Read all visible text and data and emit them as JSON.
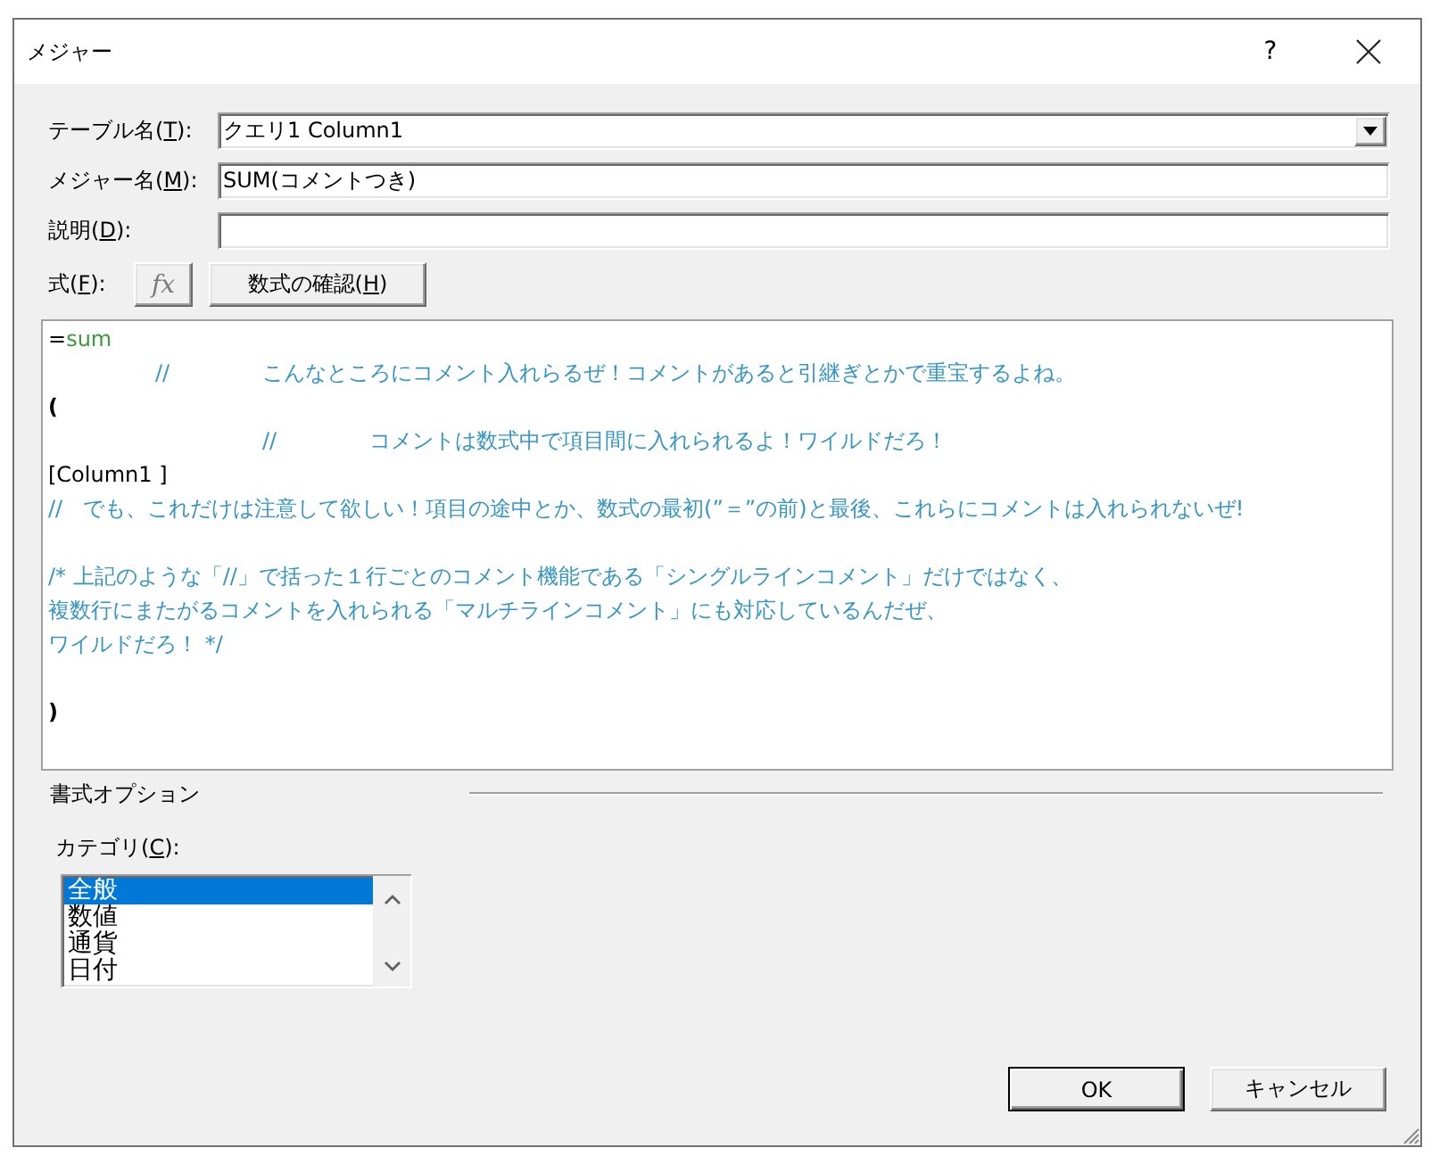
{
  "window": {
    "title": "メジャー",
    "help_button": "?"
  },
  "fields": [
    {
      "kind": "combobox",
      "label": {
        "before": "テーブル名(",
        "key": "T",
        "after": "):"
      },
      "value": "クエリ1 Column1"
    },
    {
      "kind": "textbox",
      "label": {
        "before": "メジャー名(",
        "key": "M",
        "after": "):"
      },
      "value": "SUM(コメントつき)"
    },
    {
      "kind": "textbox",
      "label": {
        "before": "説明(",
        "key": "D",
        "after": "):"
      }
    }
  ],
  "formula": {
    "label": {
      "before": "式(",
      "key": "F",
      "after": "):"
    },
    "fx_button": "fx",
    "check_button": {
      "before": "数式の確認(",
      "key": "H",
      "after": ")"
    },
    "lines": [
      {
        "kind": "code",
        "segments": [
          {
            "kind": "operator",
            "text": "="
          },
          {
            "kind": "function",
            "text": "sum"
          }
        ]
      },
      {
        "kind": "code",
        "segments": [
          {
            "kind": "comment",
            "text": "\t//\tこんなところにコメント入れらるぜ！コメントがあると引継ぎとかで重宝するよね。"
          }
        ]
      },
      {
        "kind": "code",
        "segments": [
          {
            "kind": "paren",
            "text": "("
          }
        ]
      },
      {
        "kind": "code",
        "segments": [
          {
            "kind": "comment",
            "text": "\t\t//\tコメントは数式中で項目間に入れられるよ！ワイルドだろ！"
          }
        ]
      },
      {
        "kind": "code",
        "segments": [
          {
            "kind": "reference",
            "text": "[Column1 ]"
          }
        ]
      },
      {
        "kind": "code",
        "segments": [
          {
            "kind": "comment",
            "text": "//   でも、これだけは注意して欲しい！項目の途中とか、数式の最初(”＝”の前)と最後、これらにコメントは入れられないぜ!"
          }
        ]
      },
      {
        "kind": "blank"
      },
      {
        "kind": "code",
        "segments": [
          {
            "kind": "comment",
            "text": "/* 上記のような「//」で括った１行ごとのコメント機能である「シングルラインコメント」だけではなく、"
          }
        ]
      },
      {
        "kind": "code",
        "segments": [
          {
            "kind": "comment",
            "text": "複数行にまたがるコメントを入れられる「マルチラインコメント」にも対応しているんだぜ、"
          }
        ]
      },
      {
        "kind": "code",
        "segments": [
          {
            "kind": "comment",
            "text": "ワイルドだろ！ */"
          }
        ]
      },
      {
        "kind": "blank"
      },
      {
        "kind": "code",
        "segments": [
          {
            "kind": "paren",
            "text": ")"
          }
        ]
      }
    ]
  },
  "format_options": {
    "title": "書式オプション",
    "category_label": {
      "before": "カテゴリ(",
      "key": "C",
      "after": "):"
    },
    "categories": [
      {
        "label": "全般",
        "selected": true
      },
      {
        "label": "数値",
        "selected": false
      },
      {
        "label": "通貨",
        "selected": false
      },
      {
        "label": "日付",
        "selected": false
      }
    ]
  },
  "buttons": [
    {
      "label": "OK",
      "default": true
    },
    {
      "label": "キャンセル",
      "default": false
    }
  ]
}
